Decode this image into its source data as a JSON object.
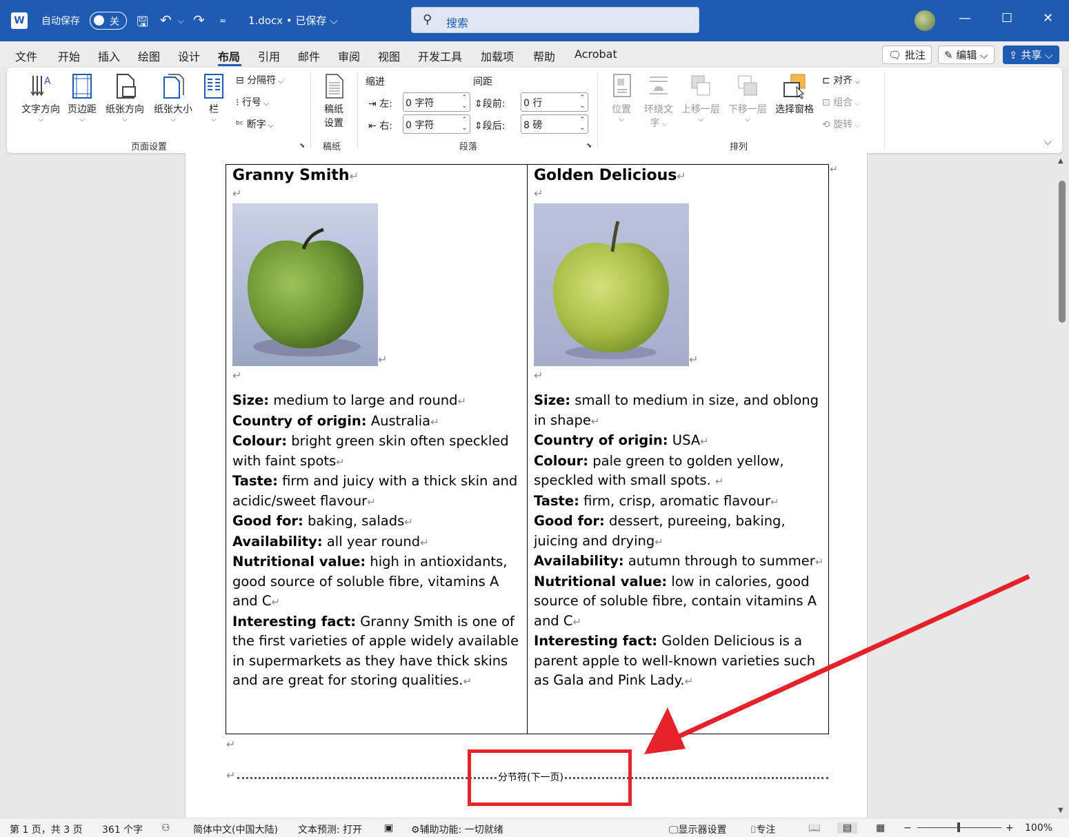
{
  "titlebar": {
    "app_logo": "W",
    "autosave_label": "自动保存",
    "autosave_state": "关",
    "doc_title": "1.docx • 已保存 ⌵",
    "search_placeholder": "搜索"
  },
  "menu": {
    "tabs": [
      "文件",
      "开始",
      "插入",
      "绘图",
      "设计",
      "布局",
      "引用",
      "邮件",
      "审阅",
      "视图",
      "开发工具",
      "加载项",
      "帮助",
      "Acrobat"
    ],
    "active_tab": "布局",
    "comment_btn": "批注",
    "edit_btn": "编辑",
    "share_btn": "共享"
  },
  "ribbon": {
    "page_setup": {
      "text_direction": "文字方向",
      "margins": "页边距",
      "orientation": "纸张方向",
      "size": "纸张大小",
      "columns": "栏",
      "breaks": "分隔符",
      "line_numbers": "行号",
      "hyphenation": "断字",
      "group_label": "页面设置"
    },
    "manuscript": {
      "settings_line1": "稿纸",
      "settings_line2": "设置",
      "group_label": "稿纸"
    },
    "paragraph": {
      "indent_label": "缩进",
      "spacing_label": "间距",
      "left_label": "左:",
      "right_label": "右:",
      "before_label": "段前:",
      "after_label": "段后:",
      "left_value": "0 字符",
      "right_value": "0 字符",
      "before_value": "0 行",
      "after_value": "8 磅",
      "group_label": "段落"
    },
    "arrange": {
      "position": "位置",
      "wrap_line1": "环绕文",
      "wrap_line2": "字",
      "bring_forward": "上移一层",
      "send_backward": "下移一层",
      "selection_pane": "选择窗格",
      "align": "对齐",
      "group": "组合",
      "rotate": "旋转",
      "group_label": "排列"
    }
  },
  "document": {
    "apples": [
      {
        "name": "Granny Smith",
        "image_desc": "granny-smith-apple",
        "props": [
          {
            "label": "Size:",
            "value": " medium to large and round"
          },
          {
            "label": "Country of origin:",
            "value": " Australia"
          },
          {
            "label": "Colour:",
            "value": " bright green skin often speckled with faint spots"
          },
          {
            "label": "Taste:",
            "value": " firm and juicy with a thick skin and acidic/sweet flavour"
          },
          {
            "label": "Good for:",
            "value": " baking, salads"
          },
          {
            "label": "Availability:",
            "value": " all year round"
          },
          {
            "label": "Nutritional value:",
            "value": " high in antioxidants, good source of soluble fibre, vitamins A and C"
          },
          {
            "label": "Interesting fact:",
            "value": " Granny Smith is one of the first varieties of apple widely available in supermarkets as they have thick skins and are great for storing qualities."
          }
        ]
      },
      {
        "name": "Golden Delicious",
        "image_desc": "golden-delicious-apple",
        "props": [
          {
            "label": "Size:",
            "value": " small to medium in size, and oblong in shape"
          },
          {
            "label": "Country of origin:",
            "value": " USA"
          },
          {
            "label": "Colour:",
            "value": " pale green to golden yellow, speckled with small spots. "
          },
          {
            "label": "Taste:",
            "value": " firm, crisp, aromatic flavour"
          },
          {
            "label": "Good for:",
            "value": " dessert, pureeing, baking, juicing and drying"
          },
          {
            "label": "Availability:",
            "value": " autumn through to summer"
          },
          {
            "label": "Nutritional value:",
            "value": " low in calories, good source of soluble fibre, contain vitamins A and C"
          },
          {
            "label": "Interesting fact:",
            "value": " Golden Delicious is a parent apple to well-known varieties such as Gala and Pink Lady."
          }
        ]
      }
    ],
    "section_break": "分节符(下一页)",
    "para_mark": "↵"
  },
  "statusbar": {
    "page": "第 1 页，共 3 页",
    "words": "361 个字",
    "language": "简体中文(中国大陆)",
    "prediction": "文本预测: 打开",
    "accessibility": "辅助功能: 一切就绪",
    "display_settings": "显示器设置",
    "focus": "专注",
    "zoom": "100%"
  },
  "colors": {
    "titlebar": "#1f5bb3",
    "annotation_red": "#e5212a"
  }
}
